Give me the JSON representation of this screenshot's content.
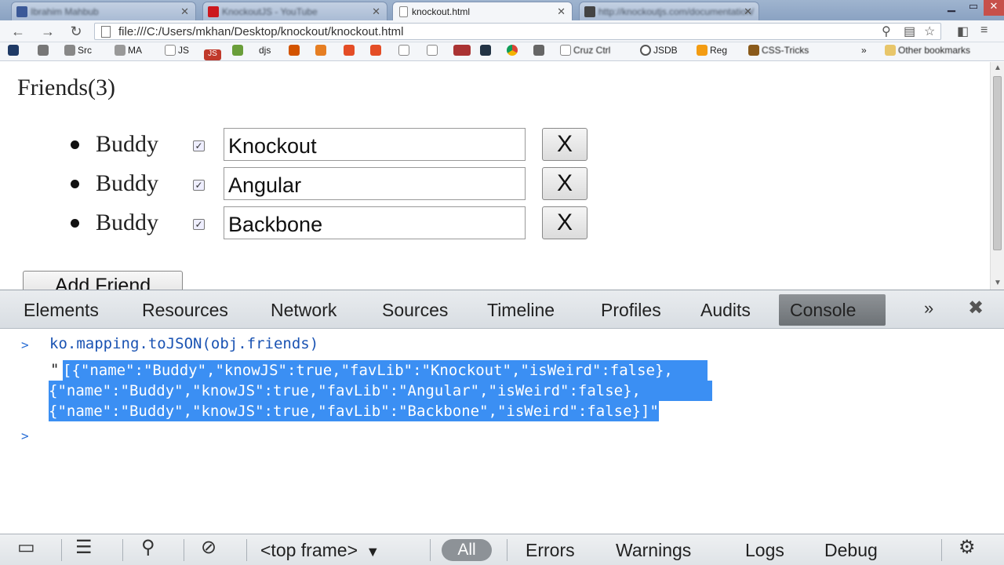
{
  "browser": {
    "tabs": [
      {
        "title": "Ibrahim Mahbub",
        "favicon_color": "#3b5998"
      },
      {
        "title": "KnockoutJS - YouTube",
        "favicon_color": "#cc181e"
      },
      {
        "title": "knockout.html",
        "favicon_color": "#ffffff"
      },
      {
        "title": "http://knockoutjs.com/documentation/",
        "favicon_color": "#444444"
      }
    ],
    "active_tab_index": 2,
    "url": "file:///C:/Users/mkhan/Desktop/knockout/knockout.html",
    "bookmarks": [
      "Src",
      "MA",
      "JS",
      "JS",
      "djs",
      "Cruz Ctrl",
      "JSDB",
      "Reg",
      "CSS-Tricks",
      "Other bookmarks"
    ]
  },
  "page": {
    "title": "Friends(3)",
    "friends": [
      {
        "name": "Buddy",
        "knowJS": true,
        "favLib": "Knockout",
        "remove_label": "X"
      },
      {
        "name": "Buddy",
        "knowJS": true,
        "favLib": "Angular",
        "remove_label": "X"
      },
      {
        "name": "Buddy",
        "knowJS": true,
        "favLib": "Backbone",
        "remove_label": "X"
      }
    ],
    "add_button": "Add Friend"
  },
  "devtools": {
    "tabs": [
      "Elements",
      "Resources",
      "Network",
      "Sources",
      "Timeline",
      "Profiles",
      "Audits",
      "Console"
    ],
    "active_tab": "Console",
    "more": "»",
    "close": "✖",
    "console": {
      "prompt": ">",
      "command": "ko.mapping.toJSON(obj.friends)",
      "result_quote": "\"",
      "result_lines": [
        "[{\"name\":\"Buddy\",\"knowJS\":true,\"favLib\":\"Knockout\",\"isWeird\":false},",
        "{\"name\":\"Buddy\",\"knowJS\":true,\"favLib\":\"Angular\",\"isWeird\":false},",
        "{\"name\":\"Buddy\",\"knowJS\":true,\"favLib\":\"Backbone\",\"isWeird\":false}]\""
      ]
    },
    "statusbar": {
      "frame_select": "<top frame>",
      "filters": [
        "All",
        "Errors",
        "Warnings",
        "Logs",
        "Debug"
      ]
    }
  },
  "colors": {
    "selection": "#3b8ff3",
    "command": "#1a53b3",
    "accent": "#2b6fd6"
  }
}
